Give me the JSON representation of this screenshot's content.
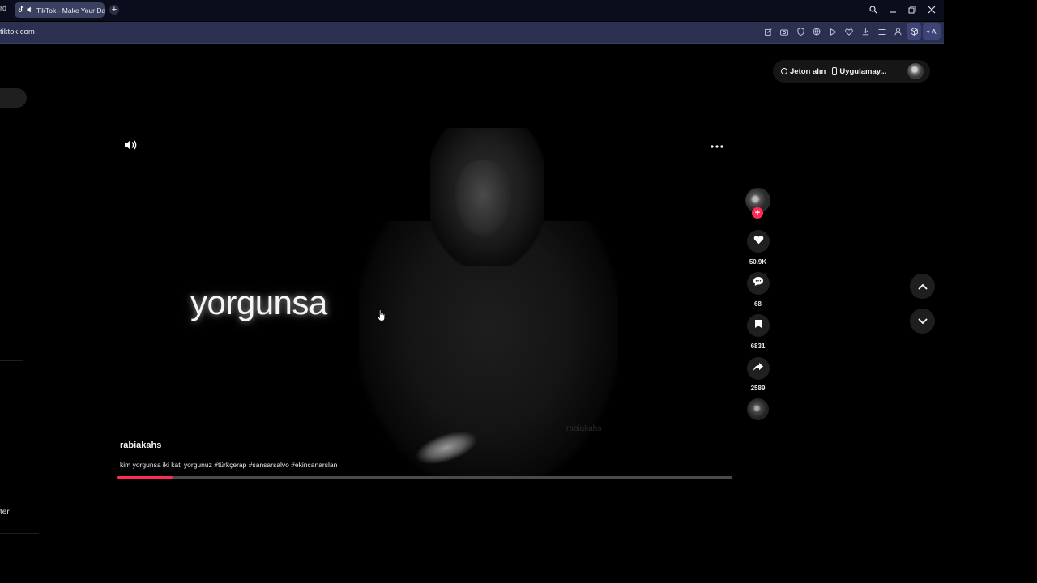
{
  "browser": {
    "prev_tab_fragment": "rd",
    "active_tab": {
      "title": "TikTok - Make Your Day",
      "favicon": "tiktok-icon",
      "audio": "speaker-icon"
    },
    "new_tab_symbol": "+",
    "url": "tiktok.com",
    "window_controls": [
      "search-icon",
      "minimize-icon",
      "restore-icon",
      "close-icon"
    ],
    "toolbar": [
      "edit-icon",
      "camera-icon",
      "shield-icon",
      "vpn-icon",
      "play-icon",
      "heart-icon",
      "download-icon",
      "list-icon",
      "user-icon",
      "cube-icon"
    ],
    "ai_label": "AI"
  },
  "header": {
    "coins_label": "Jeton alın",
    "app_label": "Uygulamay..."
  },
  "video": {
    "overlay_text": "yorgunsa",
    "watermark": "rabiakahs",
    "author": "rabiakahs",
    "caption": "kim yorgunsa iki kati yorgunuz #türkçerap #sansarsalvo #ekincanarslan",
    "progress": 0.09
  },
  "actions": {
    "likes": "50.9K",
    "comments": "68",
    "saves": "6831",
    "shares": "2589"
  },
  "sidebar": {
    "bottom_text_fragment": "ter"
  },
  "colors": {
    "accent": "#fe2c55",
    "tab_bar": "#0b0d1c",
    "address_bar": "#2b3050"
  }
}
